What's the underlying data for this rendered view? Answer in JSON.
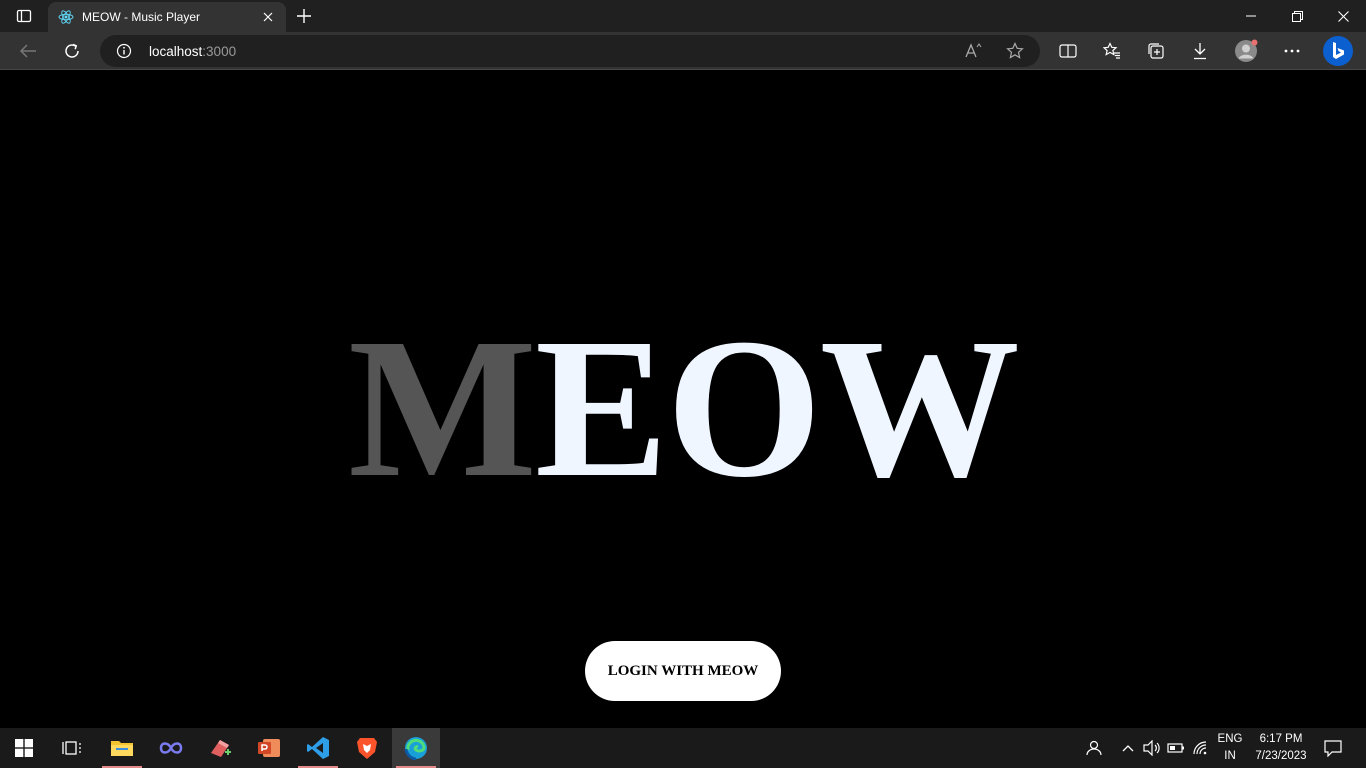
{
  "browser": {
    "tab_title": "MEOW - Music Player",
    "url_host": "localhost",
    "url_port": ":3000"
  },
  "page": {
    "logo_first": "M",
    "logo_rest": "EOW",
    "login_label": "LOGIN WITH MEOW"
  },
  "taskbar": {
    "apps": [
      "start-icon",
      "task-view-icon",
      "file-explorer-icon",
      "infinity-app-icon",
      "app-icon",
      "powerpoint-icon",
      "vscode-icon",
      "brave-icon",
      "edge-icon"
    ],
    "language_line1": "ENG",
    "language_line2": "IN",
    "time": "6:17 PM",
    "date": "7/23/2023"
  },
  "colors": {
    "logo_m": "#555555",
    "logo_rest": "#f0f6ff",
    "background": "#000000",
    "button_bg": "#ffffff"
  }
}
